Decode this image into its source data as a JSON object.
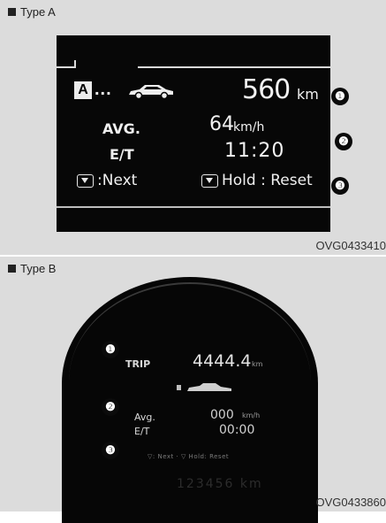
{
  "type_a": {
    "label": "Type A",
    "code": "OVG0433410",
    "screen": {
      "mode_badge": "A",
      "mode_dots": "...",
      "distance_value": "560",
      "distance_unit": "km",
      "avg_label": "AVG.",
      "avg_value": "64",
      "avg_unit": "km/h",
      "et_label": "E/T",
      "et_value": "11:20",
      "next_label": ":Next",
      "hold_label": "Hold : Reset"
    },
    "markers": [
      "❶",
      "❷",
      "❸"
    ]
  },
  "type_b": {
    "label": "Type B",
    "code": "OVG0433860",
    "screen": {
      "trip_label": "TRIP",
      "trip_value": "4444.4",
      "trip_unit": "km",
      "avg_label": "Avg.",
      "avg_value": "000",
      "avg_unit": "km/h",
      "et_label": "E/T",
      "et_value": "00:00",
      "hint_text": "▽: Next · ▽ Hold: Reset",
      "odometer": "123456 km"
    },
    "markers": [
      "❶",
      "❷",
      "❸"
    ]
  },
  "colors": {
    "panel_bg": "#dcdcdc",
    "screen_bg": "#070707",
    "text_light": "#f2f2f2"
  }
}
